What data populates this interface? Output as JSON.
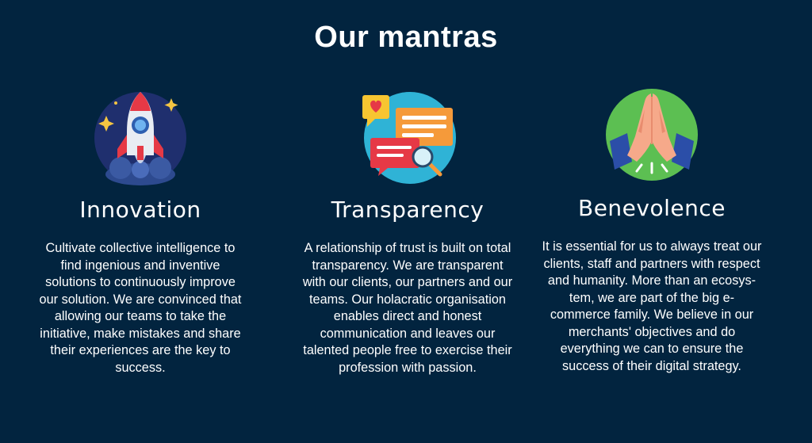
{
  "title": "Our mantras",
  "mantras": [
    {
      "icon": "rocket-icon",
      "heading": "Innovation",
      "text": "Cultivate collective intelligence to find ingenious and inventive solutions to continuously improve our solution. We are convinced that allowing our teams to take the initiative, make mistakes and share their experiences are the key to success."
    },
    {
      "icon": "chat-bubbles-icon",
      "heading": "Transparency",
      "text": "A relationship of trust is built on total transparency. We are transparent with our clients, our partners and our teams. Our holacratic organisation enables direct and honest communication and leaves our talented people free to exercise their profession with passion."
    },
    {
      "icon": "praying-hands-icon",
      "heading": "Benevolence",
      "text": "It is essential for us to always treat our clients, staff and partners with respect and humanity. More than an ecosys-tem, we are part of the big e-commerce family. We believe in our merchants' objectives and do everything we can to ensure the success of their digital strategy."
    }
  ],
  "colors": {
    "background": "#02243f",
    "rocket_circle": "#1f3a7a",
    "chat_circle": "#3bb6d6",
    "hands_circle": "#5cc25a"
  }
}
